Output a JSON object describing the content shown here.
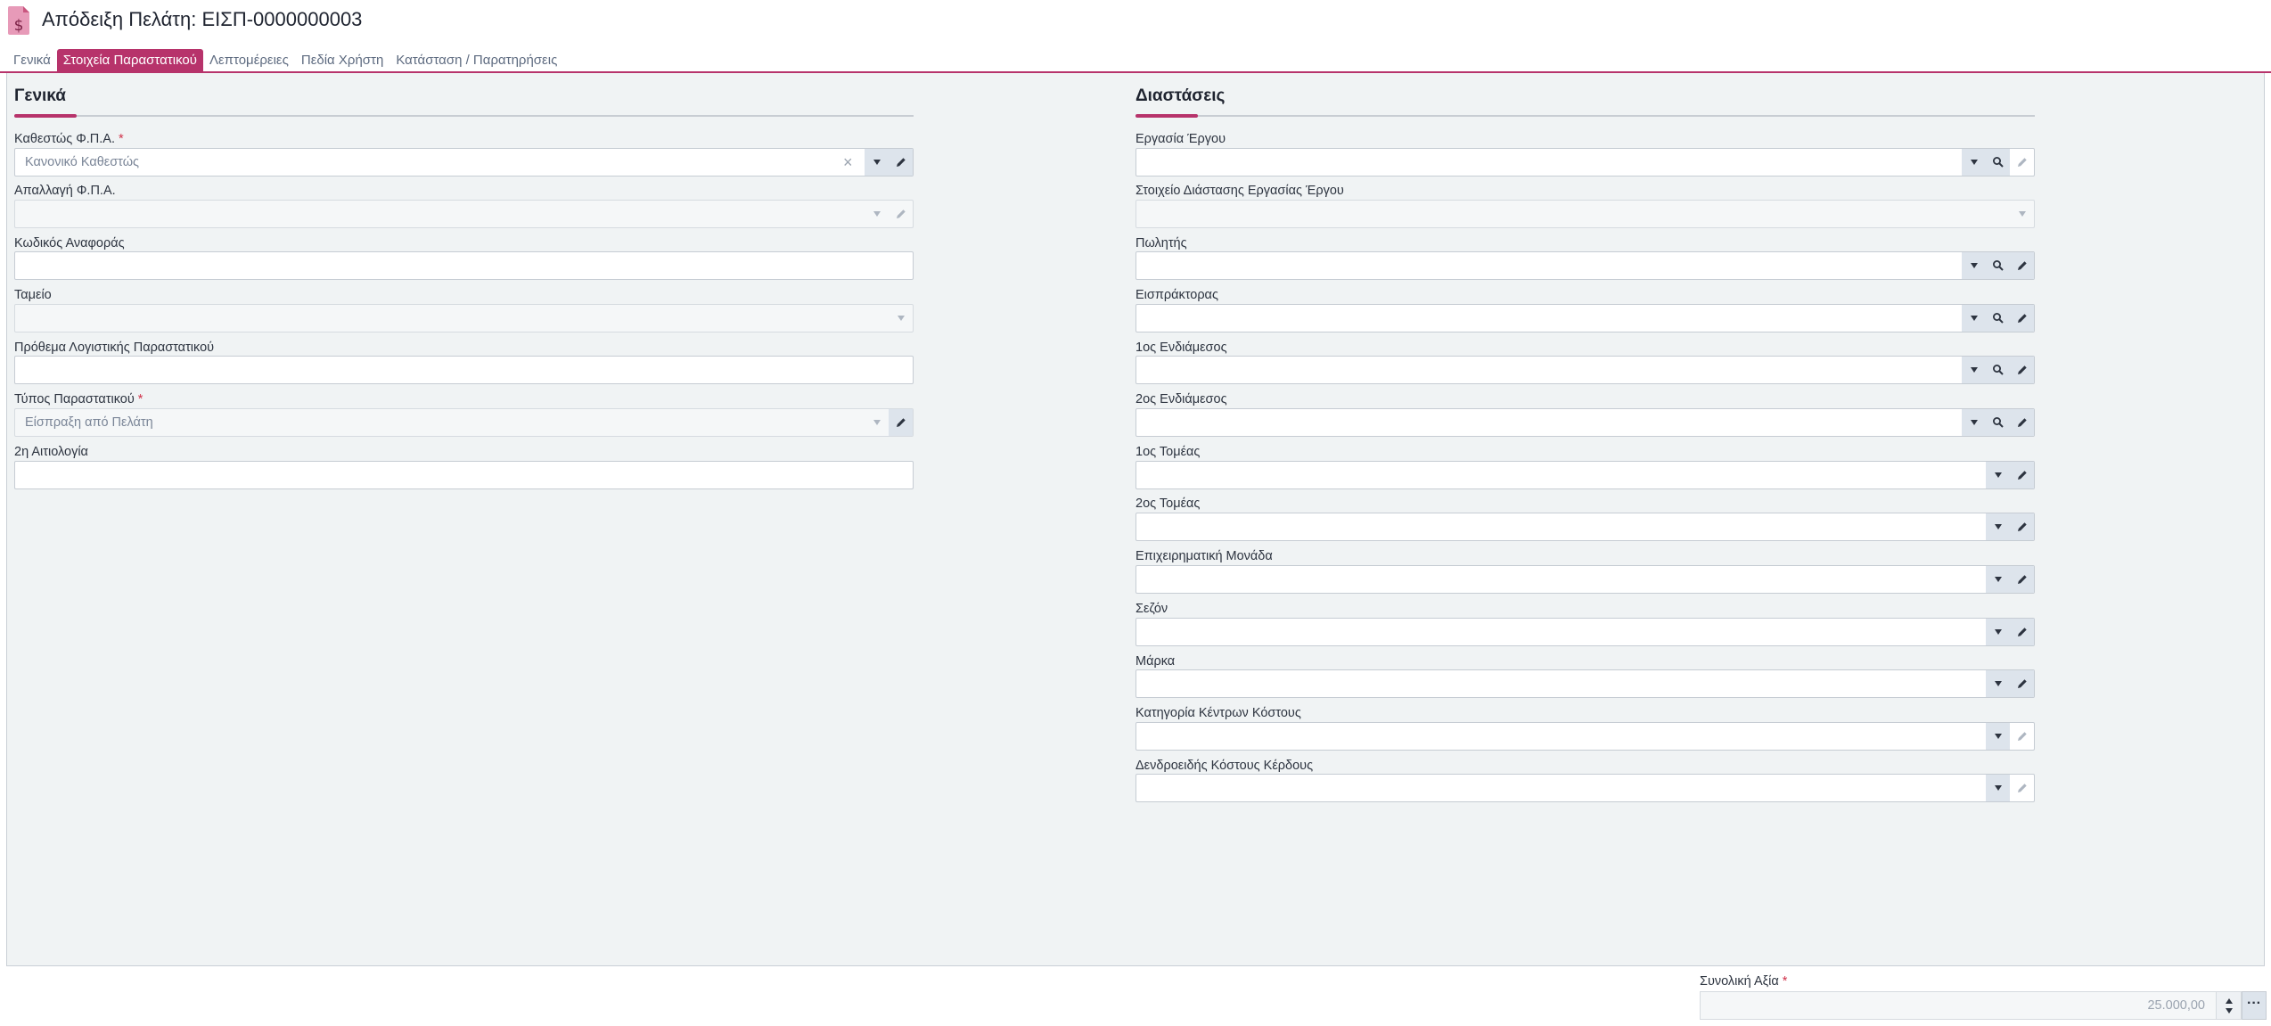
{
  "header": {
    "title": "Απόδειξη Πελάτη: ΕΙΣΠ-0000000003",
    "icon": "receipt-dollar-icon"
  },
  "tabs": [
    {
      "label": "Γενικά",
      "active": false
    },
    {
      "label": "Στοιχεία Παραστατικού",
      "active": true
    },
    {
      "label": "Λεπτομέρειες",
      "active": false
    },
    {
      "label": "Πεδία Χρήστη",
      "active": false
    },
    {
      "label": "Κατάσταση / Παρατηρήσεις",
      "active": false
    }
  ],
  "general": {
    "title": "Γενικά",
    "vat_status": {
      "label": "Καθεστώς Φ.Π.Α.",
      "value": "Κανονικό Καθεστώς"
    },
    "vat_exemption": {
      "label": "Απαλλαγή Φ.Π.Α.",
      "value": ""
    },
    "reference_code": {
      "label": "Κωδικός Αναφοράς",
      "value": ""
    },
    "cash_register": {
      "label": "Ταμείο",
      "value": ""
    },
    "accounting_prefix": {
      "label": "Πρόθεμα Λογιστικής Παραστατικού",
      "value": ""
    },
    "document_type": {
      "label": "Τύπος Παραστατικού",
      "value": "Είσπραξη από Πελάτη"
    },
    "second_reason": {
      "label": "2η Αιτιολογία",
      "value": ""
    }
  },
  "dimensions": {
    "title": "Διαστάσεις",
    "project_work": {
      "label": "Εργασία Έργου"
    },
    "project_work_dimension": {
      "label": "Στοιχείο Διάστασης Εργασίας Έργου"
    },
    "salesperson": {
      "label": "Πωλητής"
    },
    "collector": {
      "label": "Εισπράκτορας"
    },
    "intermediary_1": {
      "label": "1ος Ενδιάμεσος"
    },
    "intermediary_2": {
      "label": "2ος Ενδιάμεσος"
    },
    "sector_1": {
      "label": "1ος Τομέας"
    },
    "sector_2": {
      "label": "2ος Τομέας"
    },
    "business_unit": {
      "label": "Επιχειρηματική Μονάδα"
    },
    "season": {
      "label": "Σεζόν"
    },
    "brand": {
      "label": "Μάρκα"
    },
    "cost_center_category": {
      "label": "Κατηγορία Κέντρων Κόστους"
    },
    "cost_profit_tree": {
      "label": "Δενδροειδής Κόστους Κέρδους"
    }
  },
  "footer": {
    "total_label": "Συνολική Αξία",
    "total_value": "25.000,00"
  },
  "required_mark": "*",
  "colors": {
    "accent": "#b7336b",
    "panel_bg": "#f0f3f4",
    "button_bg": "#dde4ec"
  }
}
